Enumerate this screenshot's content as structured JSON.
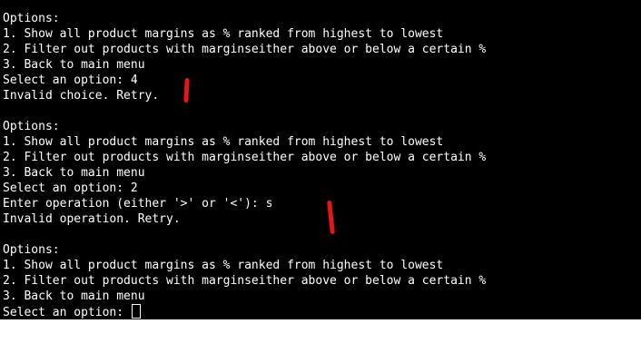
{
  "terminal": {
    "lines": [
      "Options:",
      "1. Show all product margins as % ranked from highest to lowest",
      "2. Filter out products with marginseither above or below a certain %",
      "3. Back to main menu",
      "Select an option: 4",
      "Invalid choice. Retry.",
      "",
      "Options:",
      "1. Show all product margins as % ranked from highest to lowest",
      "2. Filter out products with marginseither above or below a certain %",
      "3. Back to main menu",
      "Select an option: 2",
      "Enter operation (either '>' or '<'): s",
      "Invalid operation. Retry.",
      "",
      "Options:",
      "1. Show all product margins as % ranked from highest to lowest",
      "2. Filter out products with marginseither above or below a certain %",
      "3. Back to main menu"
    ],
    "prompt": "Select an option: ",
    "background_color": "#000000",
    "text_color": "#ffffff",
    "annotation_color": "#e8141b"
  }
}
